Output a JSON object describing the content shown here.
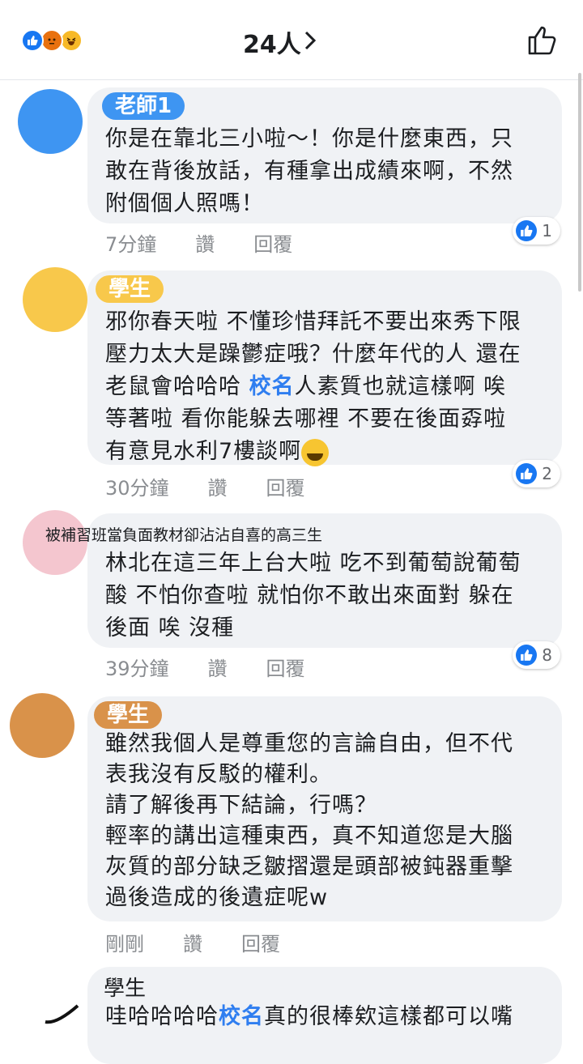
{
  "header": {
    "reaction_count": "24人",
    "reactions": [
      "like-icon",
      "angry-icon",
      "haha-icon"
    ]
  },
  "comments": [
    {
      "name": "老師1",
      "text": "你是在靠北三小啦～！你是什麼東西，只\n敢在背後放話，有種拿出成績來啊，不然\n附個個人照嗎！",
      "time": "7分鐘",
      "like_label": "讚",
      "reply_label": "回覆",
      "like_count": "1"
    },
    {
      "name": "學生",
      "text_part1": "邪你春天啦 不懂珍惜拜託不要出來秀下限\n壓力太大是躁鬱症哦？什麼年代的人 還在\n老鼠會哈哈哈 ",
      "school": "校名",
      "text_part2": "人素質也就這樣啊 唉\n等著啦 看你能躲去哪裡 不要在後面孬啦\n有意見水利7樓談啊",
      "time": "30分鐘",
      "like_label": "讚",
      "reply_label": "回覆",
      "like_count": "2"
    },
    {
      "name": "被補習班當負面教材卻沾沾自喜的高三生",
      "text": "林北在這三年上台大啦 吃不到葡萄說葡萄\n酸 不怕你查啦 就怕你不敢出來面對 躲在\n後面 唉 沒種",
      "time": "39分鐘",
      "like_label": "讚",
      "reply_label": "回覆",
      "like_count": "8"
    },
    {
      "name": "學生",
      "text": "雖然我個人是尊重您的言論自由，但不代\n表我沒有反駁的權利。\n請了解後再下結論，行嗎？\n輕率的講出這種東西，真不知道您是大腦\n灰質的部分缺乏皺摺還是頭部被鈍器重擊\n過後造成的後遺症呢w",
      "time": "剛剛",
      "like_label": "讚",
      "reply_label": "回覆"
    },
    {
      "name": "學生",
      "text_part1": "哇哈哈哈哈",
      "school": "校名",
      "text_part2": "真的很棒欸這樣都可以嘴"
    }
  ],
  "colors": {
    "accent": "#1877f2",
    "bubble": "#f0f2f5",
    "meta": "#8a8d91",
    "school_text": "#2f7ef0"
  }
}
